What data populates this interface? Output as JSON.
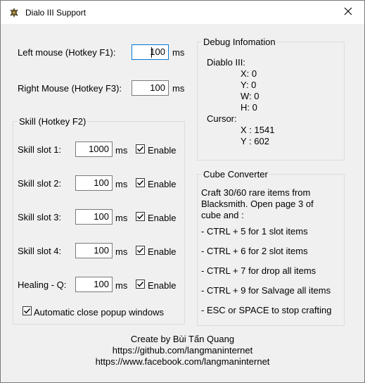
{
  "window": {
    "title": "Dialo III Support",
    "icon": "diablo-app-icon",
    "close_icon": "close-icon"
  },
  "left_mouse": {
    "label": "Left mouse (Hotkey F1):",
    "value": "100",
    "unit": "ms"
  },
  "right_mouse": {
    "label": "Right Mouse (Hotkey F3):",
    "value": "100",
    "unit": "ms"
  },
  "skill_group": {
    "title": "Skill (Hotkey F2)",
    "slots": [
      {
        "label": "Skill slot 1:",
        "value": "1000",
        "unit": "ms",
        "enable_label": "Enable",
        "checked": true
      },
      {
        "label": "Skill slot 2:",
        "value": "100",
        "unit": "ms",
        "enable_label": "Enable",
        "checked": true
      },
      {
        "label": "Skill slot 3:",
        "value": "100",
        "unit": "ms",
        "enable_label": "Enable",
        "checked": true
      },
      {
        "label": "Skill slot 4:",
        "value": "100",
        "unit": "ms",
        "enable_label": "Enable",
        "checked": true
      },
      {
        "label": "Healing - Q:",
        "value": "100",
        "unit": "ms",
        "enable_label": "Enable",
        "checked": true
      }
    ],
    "auto_close": {
      "label": "Automatic close popup windows",
      "checked": true
    }
  },
  "debug": {
    "title": "Debug Infomation",
    "diablo_label": "Diablo III:",
    "diablo_x": "X: 0",
    "diablo_y": "Y: 0",
    "diablo_w": "W: 0",
    "diablo_h": "H: 0",
    "cursor_label": "Cursor:",
    "cursor_x": "X : 1541",
    "cursor_y": "Y : 602"
  },
  "cube": {
    "title": "Cube Converter",
    "intro_1": "Craft 30/60 rare items from",
    "intro_2": "Blacksmith. Open page 3 of",
    "intro_3": "cube and :",
    "line_1": "- CTRL + 5 for 1 slot items",
    "line_2": "- CTRL + 6 for 2 slot items",
    "line_3": "- CTRL + 7 for drop all items",
    "line_4": "- CTRL + 9 for Salvage all items",
    "line_5": "- ESC or SPACE to stop crafting"
  },
  "footer": {
    "credit": "Create by Bùi Tấn Quang",
    "github": "https://github.com/langmaninternet",
    "facebook": "https://www.facebook.com/langmaninternet"
  }
}
